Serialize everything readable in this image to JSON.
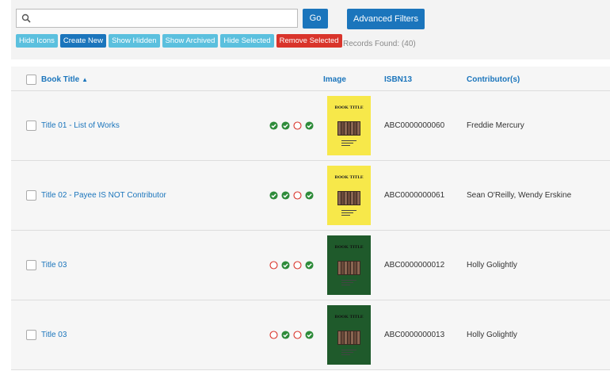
{
  "search": {
    "placeholder": "",
    "value": ""
  },
  "toolbar": {
    "go_label": "Go",
    "advanced_filters_label": "Advanced Filters",
    "actions": [
      "Hide Icons",
      "Create New",
      "Show Hidden",
      "Show Archived",
      "Hide Selected",
      "Remove Selected"
    ],
    "records_found": "Records Found: (40)"
  },
  "table": {
    "headers": {
      "title": "Book Title",
      "image": "Image",
      "isbn": "ISBN13",
      "contributors": "Contributor(s)"
    },
    "sort_indicator": "▲",
    "rows": [
      {
        "title": "Title 01 - List of Works",
        "isbn": "ABC0000000060",
        "contributors": "Freddie Mercury",
        "statuses": [
          "ok",
          "ok",
          "empty",
          "ok"
        ],
        "cover_color": "#f7e84a",
        "cover_text": "BOOK TITLE"
      },
      {
        "title": "Title 02 - Payee IS NOT Contributor",
        "isbn": "ABC0000000061",
        "contributors": "Sean O'Reilly, Wendy Erskine",
        "statuses": [
          "ok",
          "ok",
          "empty",
          "ok"
        ],
        "cover_color": "#f7e84a",
        "cover_text": "BOOK TITLE"
      },
      {
        "title": "Title 03",
        "isbn": "ABC0000000012",
        "contributors": "Holly Golightly",
        "statuses": [
          "empty",
          "ok",
          "empty",
          "ok"
        ],
        "cover_color": "#1f5a2b",
        "cover_text": "BOOK TITLE"
      },
      {
        "title": "Title 03",
        "isbn": "ABC0000000013",
        "contributors": "Holly Golightly",
        "statuses": [
          "empty",
          "ok",
          "empty",
          "ok"
        ],
        "cover_color": "#1f5a2b",
        "cover_text": "BOOK TITLE"
      }
    ]
  },
  "colors": {
    "primary": "#1b75bc",
    "info": "#5bc0de",
    "danger": "#d9342b",
    "ok": "#2e8b3a",
    "empty_ring": "#d9342b"
  }
}
